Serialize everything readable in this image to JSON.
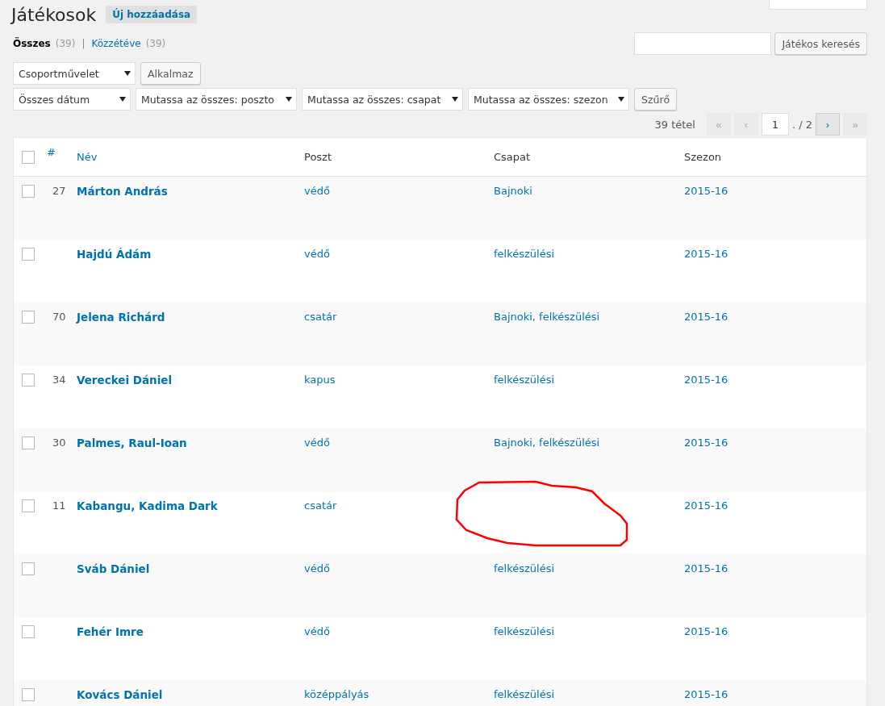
{
  "title": "Játékosok",
  "add_button": "Új hozzáadása",
  "views": [
    {
      "label": "Összes",
      "count": "(39)",
      "selected": true
    },
    {
      "label": "Közzétéve",
      "count": "(39)",
      "selected": false
    }
  ],
  "view_separator": "|",
  "search": {
    "button": "Játékos keresés"
  },
  "bulk": {
    "select": "Csoportművelet",
    "apply": "Alkalmaz"
  },
  "filters": [
    "Összes dátum",
    "Mutassa az összes: poszto",
    "Mutassa az összes: csapat",
    "Mutassa az összes: szezon"
  ],
  "filter_button": "Szűrő",
  "pagination": {
    "count": "39 tétel",
    "first": "«",
    "prev": "‹",
    "page": "1",
    "of": ". / 2",
    "next": "›",
    "last": "»"
  },
  "table": {
    "select_all_checked": false,
    "columns": [
      "#",
      "Név",
      "Poszt",
      "Csapat",
      "Szezon"
    ],
    "rows": [
      {
        "number": "27",
        "name": "Márton András",
        "poszt": "védő",
        "csapat": "Bajnoki",
        "szezon": "2015-16",
        "checked": false
      },
      {
        "name": "Hajdú Ádám",
        "poszt": "védő",
        "csapat": "felkészülési",
        "szezon": "2015-16",
        "checked": false
      },
      {
        "number": "70",
        "name": "Jelena Richárd",
        "poszt": "csatár",
        "csapat": "Bajnoki, felkészülési",
        "szezon": "2015-16",
        "checked": false
      },
      {
        "number": "34",
        "name": "Vereckei Dániel",
        "poszt": "kapus",
        "csapat": "felkészülési",
        "szezon": "2015-16",
        "checked": false
      },
      {
        "number": "30",
        "name": "Palmes, Raul-Ioan",
        "poszt": "védő",
        "csapat": "Bajnoki, felkészülési",
        "szezon": "2015-16",
        "checked": false
      },
      {
        "number": "11",
        "name": "Kabangu, Kadima Dark",
        "poszt": "csatár",
        "szezon": "2015-16",
        "checked": false
      },
      {
        "name": "Sváb Dániel",
        "poszt": "védő",
        "csapat": "felkészülési",
        "szezon": "2015-16",
        "checked": false
      },
      {
        "name": "Fehér Imre",
        "poszt": "védő",
        "csapat": "felkészülési",
        "szezon": "2015-16",
        "checked": false
      },
      {
        "name": "Kovács Dániel",
        "poszt": "középpályás",
        "csapat": "felkészülési",
        "szezon": "2015-16",
        "checked": false
      }
    ]
  }
}
